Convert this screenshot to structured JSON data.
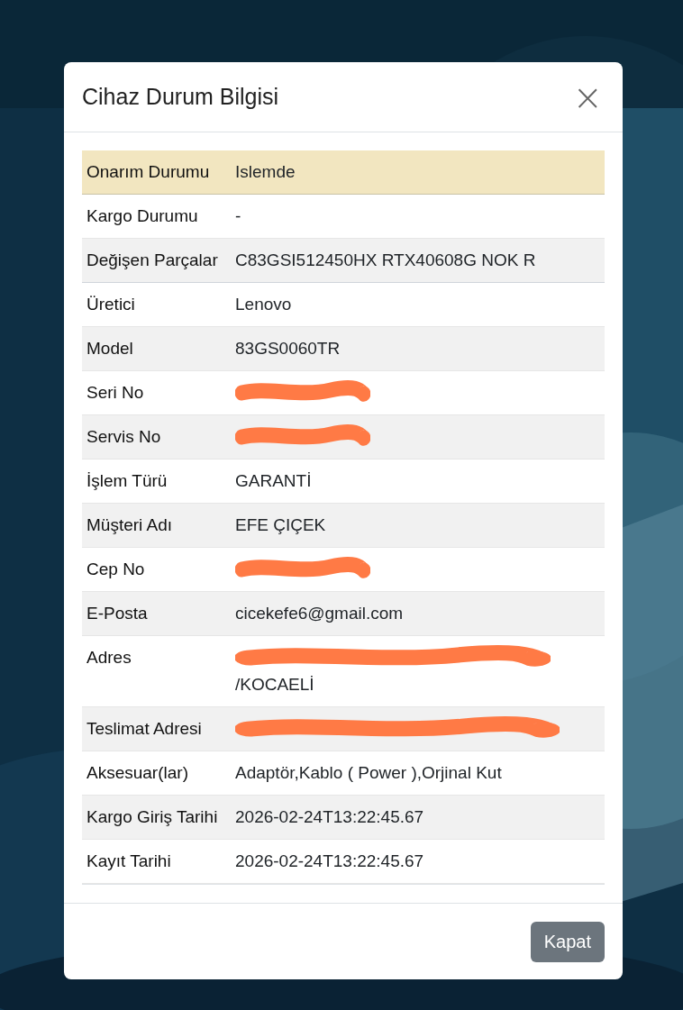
{
  "modal": {
    "title": "Cihaz Durum Bilgisi",
    "close_symbol": "×"
  },
  "rows": [
    {
      "label": "Onarım Durumu",
      "value": "Islemde",
      "kind": "warning",
      "redacted": false
    },
    {
      "label": "Kargo Durumu",
      "value": "-",
      "kind": "plain",
      "redacted": false
    },
    {
      "label": "Değişen Parçalar",
      "value": "C83GSI512450HX RTX40608G NOK R",
      "kind": "plain",
      "redacted": false
    },
    {
      "label": "Üretici",
      "value": "Lenovo",
      "kind": "plain",
      "redacted": false
    },
    {
      "label": "Model",
      "value": "83GS0060TR",
      "kind": "plain",
      "redacted": false
    },
    {
      "label": "Seri No",
      "kind": "plain",
      "redacted": true
    },
    {
      "label": "Servis No",
      "kind": "plain",
      "redacted": true
    },
    {
      "label": "İşlem Türü",
      "value": "GARANTİ",
      "kind": "plain",
      "redacted": false
    },
    {
      "label": "Müşteri Adı",
      "value": "EFE ÇIÇEK",
      "kind": "plain",
      "redacted": false
    },
    {
      "label": "Cep No",
      "kind": "plain",
      "redacted": true
    },
    {
      "label": "E-Posta",
      "value": "cicekefe6@gmail.com",
      "kind": "plain",
      "redacted": false
    },
    {
      "label": "Adres",
      "value": "/KOCAELİ",
      "kind": "plain",
      "redacted": true
    },
    {
      "label": "Teslimat Adresi",
      "kind": "plain",
      "redacted": true
    },
    {
      "label": "Aksesuar(lar)",
      "value": "Adaptör,Kablo ( Power ),Orjinal Kut",
      "kind": "plain",
      "redacted": false
    },
    {
      "label": "Kargo Giriş Tarihi",
      "value": "2026-02-24T13:22:45.67",
      "kind": "plain",
      "redacted": false
    },
    {
      "label": "Kayıt Tarihi",
      "value": "2026-02-24T13:22:45.67",
      "kind": "plain",
      "redacted": false
    }
  ],
  "footer": {
    "button": "Kapat"
  }
}
